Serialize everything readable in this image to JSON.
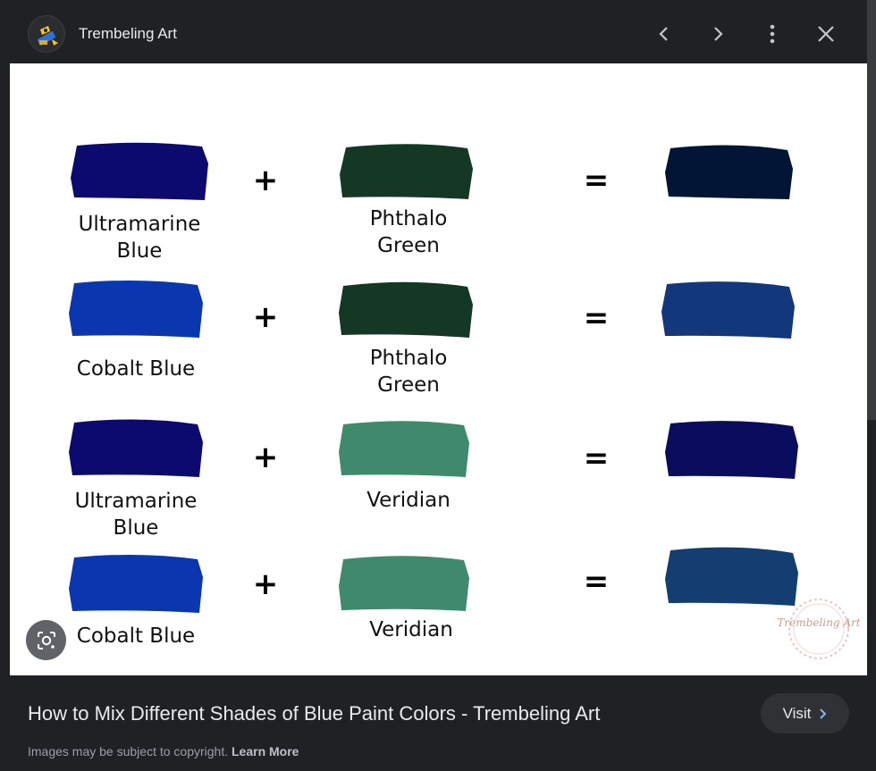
{
  "header": {
    "site_name": "Trembeling Art",
    "avatar_icon": "pencil-mascot-icon",
    "prev_icon": "chevron-left-icon",
    "next_icon": "chevron-right-icon",
    "more_icon": "more-vert-icon",
    "close_icon": "close-icon"
  },
  "image": {
    "plus_sign": "+",
    "equals_sign": "=",
    "rows": [
      {
        "left_label": [
          "Ultramarine",
          "Blue"
        ],
        "left_color": "#0c0a6e",
        "mid_label": [
          "Phthalo",
          "Green"
        ],
        "mid_color": "#153726",
        "result_color": "#021535"
      },
      {
        "left_label": [
          "Cobalt Blue"
        ],
        "left_color": "#0a37b0",
        "mid_label": [
          "Phthalo",
          "Green"
        ],
        "mid_color": "#153726",
        "result_color": "#12377b"
      },
      {
        "left_label": [
          "Ultramarine",
          "Blue"
        ],
        "left_color": "#0c0a6e",
        "mid_label": [
          "Veridian"
        ],
        "mid_color": "#3f8a6c",
        "result_color": "#0a0c5e"
      },
      {
        "left_label": [
          "Cobalt Blue"
        ],
        "left_color": "#0a37b0",
        "mid_label": [
          "Veridian"
        ],
        "mid_color": "#3f8a6c",
        "result_color": "#123e72"
      }
    ],
    "watermark_icon": "trembeling-art-watermark-icon",
    "watermark_text": "Trembeling Art"
  },
  "lens": {
    "icon": "google-lens-icon"
  },
  "caption": {
    "title": "How to Mix Different Shades of Blue Paint Colors - Trembeling Art",
    "visit_label": "Visit",
    "visit_icon": "chevron-right-icon",
    "copyright_text": "Images may be subject to copyright.",
    "learn_more": "Learn More"
  },
  "colors": {
    "background": "#202124",
    "text": "#e8eaed",
    "muted": "#9aa0a6",
    "visit_chevron": "#8ab4f8"
  }
}
